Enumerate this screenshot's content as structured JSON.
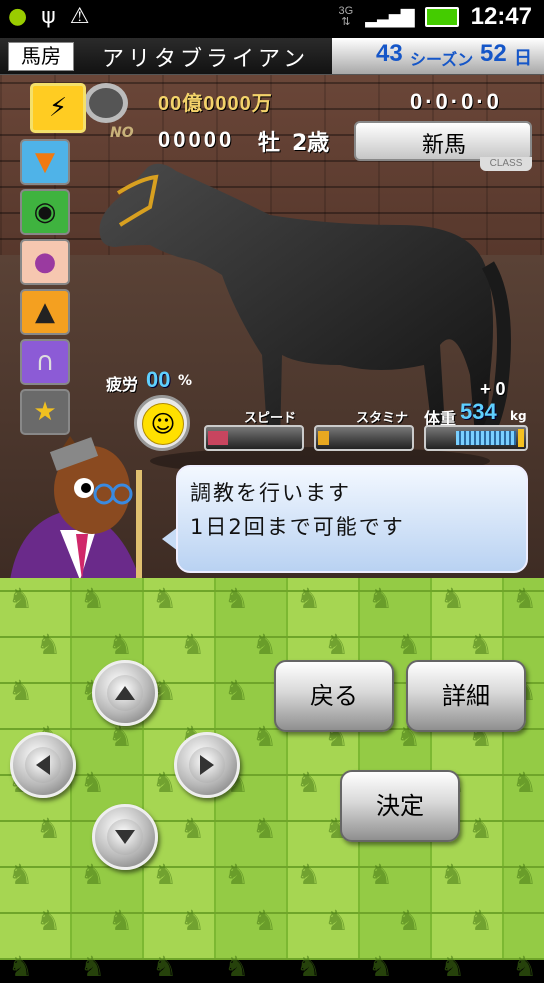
{
  "status_bar": {
    "time": "12:47",
    "network": "3G"
  },
  "header": {
    "tab_label": "馬房",
    "horse_name": "アリタブライアン",
    "season_number": "43",
    "season_label": "シーズン",
    "day_number": "52",
    "day_label": "日"
  },
  "horse_info": {
    "money_text": "00億0000万",
    "record": "0·0·0·0",
    "no_label": "NO",
    "number": "00000",
    "sex": "牡",
    "age": "2歳",
    "class_value": "新馬",
    "class_tag": "CLASS"
  },
  "menu_icons": [
    "stable-icon",
    "carrot-icon",
    "binoculars-icon",
    "jockey-icon",
    "horse-silhouette-icon",
    "horseshoe-icon",
    "trophy-icon"
  ],
  "stats": {
    "fatigue_label": "疲労",
    "fatigue_value": "00",
    "fatigue_unit": "%",
    "speed_label": "スピード",
    "speed_level": 0.22,
    "stamina_label": "スタミナ",
    "stamina_level": 0.12,
    "weight_label": "体重",
    "weight_value": "534",
    "weight_unit": "kg",
    "weight_change": "+ 0"
  },
  "message": {
    "line1": "調教を行います",
    "line2": "1日2回まで可能です"
  },
  "controls": {
    "back_label": "戻る",
    "detail_label": "詳細",
    "confirm_label": "決定"
  },
  "colors": {
    "accent_blue": "#1556c8",
    "field_green": "#8cc63c",
    "speed_bar": "#c8455f",
    "stamina_bar": "#e8a820"
  }
}
